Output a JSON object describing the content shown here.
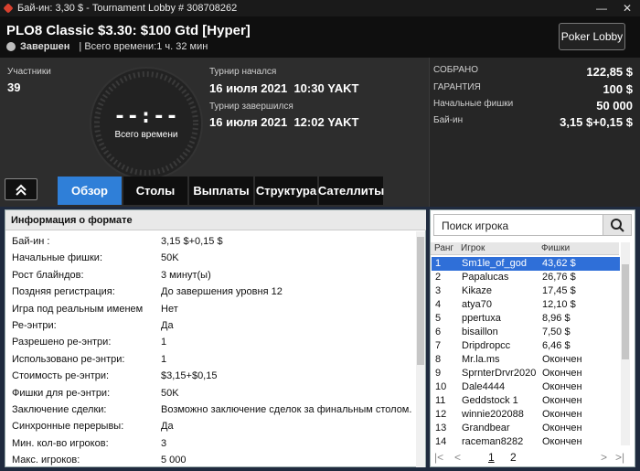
{
  "window": {
    "title": "Бай-ин: 3,30 $ - Tournament Lobby # 308708262",
    "minimize": "—",
    "close": "✕"
  },
  "header": {
    "tournament_name": "PLO8 Classic $3.30: $100 Gtd [Hyper]",
    "status": "Завершен",
    "total_time": "| Всего времени:1 ч. 32 мин",
    "lobby_button": "Poker Lobby"
  },
  "info": {
    "participants_label": "Участники",
    "participants": "39",
    "clock_display": "--:--",
    "clock_label": "Всего времени",
    "started_label": "Турнир начался",
    "started": "16 июля 2021  10:30 YAKT",
    "finished_label": "Турнир завершился",
    "finished": "16 июля 2021  12:02 YAKT"
  },
  "stats": [
    {
      "label": "СОБРАНО",
      "value": "122,85 $"
    },
    {
      "label": "ГАРАНТИЯ",
      "value": "100 $"
    },
    {
      "label": "Начальные фишки",
      "value": "50 000"
    },
    {
      "label": "Бай-ин",
      "value": "3,15 $+0,15 $"
    }
  ],
  "tabs": [
    "Обзор",
    "Столы",
    "Выплаты",
    "Структура",
    "Сателлиты"
  ],
  "active_tab": "Обзор",
  "format": {
    "title": "Информация о формате",
    "rows": [
      {
        "k": "Бай-ин :",
        "v": "3,15 $+0,15 $"
      },
      {
        "k": "Начальные фишки:",
        "v": "50K"
      },
      {
        "k": "Рост блайндов:",
        "v": "3 минут(ы)"
      },
      {
        "k": "Поздняя регистрация:",
        "v": "До завершения уровня 12"
      },
      {
        "k": "Игра под реальным именем",
        "v": "Нет"
      },
      {
        "k": "Ре-энтри:",
        "v": "Да"
      },
      {
        "k": "Разрешено ре-энтри:",
        "v": "1"
      },
      {
        "k": "Использовано ре-энтри:",
        "v": "1"
      },
      {
        "k": "Стоимость ре-энтри:",
        "v": "$3,15+$0,15"
      },
      {
        "k": "Фишки для ре-энтри:",
        "v": "50K"
      },
      {
        "k": "Заключение сделки:",
        "v": "Возможно заключение сделок за финальным столом."
      },
      {
        "k": "Синхронные перерывы:",
        "v": "Да"
      },
      {
        "k": "Мин. кол-во игроков:",
        "v": "3"
      },
      {
        "k": "Макс. игроков:",
        "v": "5 000"
      }
    ]
  },
  "players": {
    "search_placeholder": "Поиск игрока",
    "columns": [
      "Ранг",
      "Игрок",
      "Фишки"
    ],
    "rows": [
      {
        "rank": "1",
        "name": "Sm1le_of_god",
        "chips": "43,62 $"
      },
      {
        "rank": "2",
        "name": "Papalucas",
        "chips": "26,76 $"
      },
      {
        "rank": "3",
        "name": "Kikaze",
        "chips": "17,45 $"
      },
      {
        "rank": "4",
        "name": "atya70",
        "chips": "12,10 $"
      },
      {
        "rank": "5",
        "name": "ppertuxa",
        "chips": "8,96 $"
      },
      {
        "rank": "6",
        "name": "bisaillon",
        "chips": "7,50 $"
      },
      {
        "rank": "7",
        "name": "Dripdropcc",
        "chips": "6,46 $"
      },
      {
        "rank": "8",
        "name": "Mr.la.ms",
        "chips": "Окончен"
      },
      {
        "rank": "9",
        "name": "SprnterDrvr2020",
        "chips": "Окончен"
      },
      {
        "rank": "10",
        "name": "Dale4444",
        "chips": "Окончен"
      },
      {
        "rank": "11",
        "name": "Geddstock 1",
        "chips": "Окончен"
      },
      {
        "rank": "12",
        "name": "winnie202088",
        "chips": "Окончен"
      },
      {
        "rank": "13",
        "name": "Grandbear",
        "chips": "Окончен"
      },
      {
        "rank": "14",
        "name": "raceman8282",
        "chips": "Окончен"
      }
    ],
    "selected_rank": "1",
    "pages": [
      "1",
      "2"
    ],
    "current_page": "1"
  },
  "colors": {
    "accent": "#2f7fd8",
    "selection": "#2f6fd8"
  }
}
